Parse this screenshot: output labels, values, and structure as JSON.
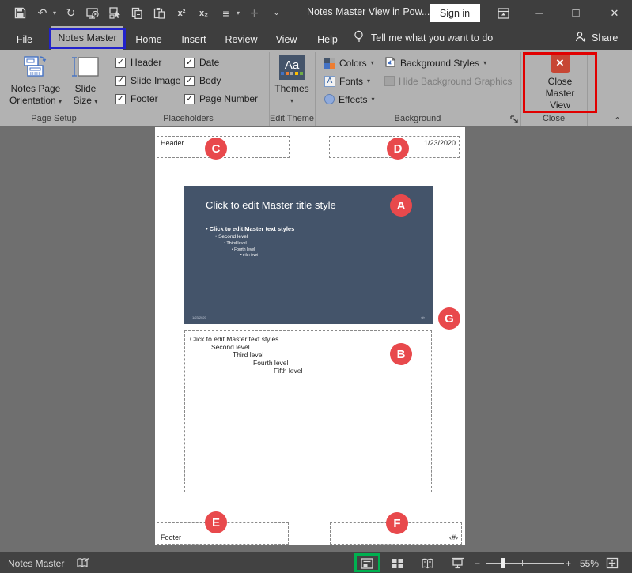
{
  "colors": {
    "titlebar": "#3E3E3E",
    "ribbon": "#B2B2B2",
    "canvas": "#6F6F6F",
    "slide_bg": "#44546A",
    "circle_red": "#E8494C",
    "annotation_red": "#E10000",
    "annotation_blue": "#2222CB",
    "annotation_green": "#00B050",
    "close_icon_bg": "#C74634"
  },
  "icons": {
    "caret": "▾",
    "check": "✓",
    "chevron_up": "⌃",
    "more": "⌄",
    "undo": "↶",
    "redo": "↻",
    "align": "≡",
    "superscript": "x²",
    "subscript": "x₂",
    "minimize": "─",
    "maximize": "□",
    "close": "✕",
    "close_master_x": "✕",
    "zoom_minus": "−",
    "zoom_plus": "+"
  },
  "titlebar": {
    "title": "Notes Master View in Pow...",
    "sign_in": "Sign in"
  },
  "menubar": {
    "tabs": [
      {
        "label": "File"
      },
      {
        "label": "Notes Master",
        "active": true
      },
      {
        "label": "Home"
      },
      {
        "label": "Insert"
      },
      {
        "label": "Review"
      },
      {
        "label": "View"
      },
      {
        "label": "Help"
      }
    ],
    "tellme": "Tell me what you want to do",
    "share": "Share"
  },
  "ribbon": {
    "page_setup": {
      "label": "Page Setup",
      "orientation_line1": "Notes Page",
      "orientation_line2": "Orientation",
      "slide_size_line1": "Slide",
      "slide_size_line2": "Size"
    },
    "placeholders": {
      "label": "Placeholders",
      "items": [
        {
          "label": "Header",
          "checked": true
        },
        {
          "label": "Slide Image",
          "checked": true
        },
        {
          "label": "Footer",
          "checked": true
        },
        {
          "label": "Date",
          "checked": true
        },
        {
          "label": "Body",
          "checked": true
        },
        {
          "label": "Page Number",
          "checked": true
        }
      ]
    },
    "edit_theme": {
      "label": "Edit Theme",
      "themes": "Themes",
      "themes_icon_text": "Aa"
    },
    "background": {
      "label": "Background",
      "colors": "Colors",
      "fonts": "Fonts",
      "fonts_icon_text": "A",
      "effects": "Effects",
      "styles": "Background Styles",
      "hide_graphics": "Hide Background Graphics"
    },
    "close": {
      "label": "Close",
      "button_line1": "Close",
      "button_line2": "Master View"
    }
  },
  "page": {
    "header": "Header",
    "date": "1/23/2020",
    "footer": "Footer",
    "page_number": "‹#›",
    "slide": {
      "title": "Click to edit Master title style",
      "bullets": [
        "• Click to edit Master text styles",
        "• Second level",
        "• Third level",
        "• Fourth level",
        "• Fifth level"
      ],
      "date": "1/23/2020",
      "number": "‹#›"
    },
    "body_lines": [
      "Click to edit Master text styles",
      "Second level",
      "Third level",
      "Fourth level",
      "Fifth level"
    ]
  },
  "annotations": {
    "circles": [
      {
        "letter": "A"
      },
      {
        "letter": "B"
      },
      {
        "letter": "C"
      },
      {
        "letter": "D"
      },
      {
        "letter": "E"
      },
      {
        "letter": "F"
      },
      {
        "letter": "G"
      }
    ]
  },
  "statusbar": {
    "view_label": "Notes Master",
    "zoom_percent": "55%"
  }
}
